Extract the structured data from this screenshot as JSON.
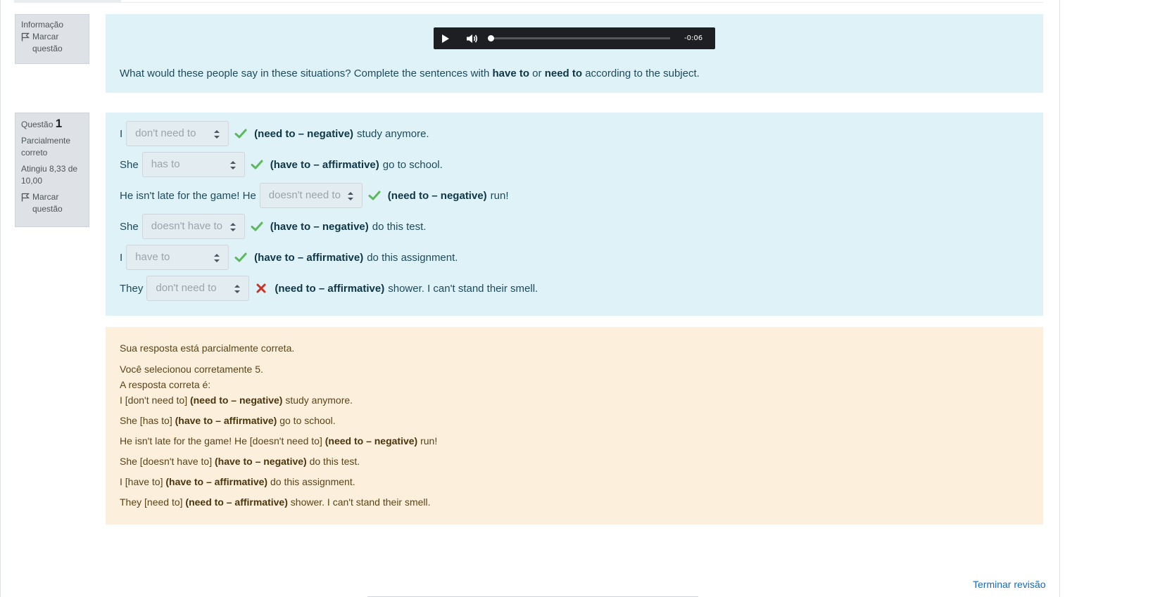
{
  "info_box": {
    "title": "Informação",
    "flag_label": "Marcar questão"
  },
  "info_panel": {
    "audio": {
      "time": "-0:06"
    },
    "instruction_pre": "What would these people say in these situations? Complete the sentences with ",
    "instruction_bold1": "have to",
    "instruction_mid": " or ",
    "instruction_bold2": "need to",
    "instruction_post": " according to the subject."
  },
  "question_box": {
    "label": "Questão",
    "number": "1",
    "state": "Parcialmente correto",
    "grade": "Atingiu 8,33 de 10,00",
    "flag_label": "Marcar questão"
  },
  "question": {
    "rows": [
      {
        "pre": "I",
        "selected": "don't need to",
        "mark": "correct",
        "hint": "(need to – negative)",
        "post": "study anymore."
      },
      {
        "pre": "She",
        "selected": "has to",
        "mark": "correct",
        "hint": "(have to – affirmative)",
        "post": "go to school."
      },
      {
        "pre": "He isn't late for the game! He",
        "selected": "doesn't need to",
        "mark": "correct",
        "hint": "(need to – negative)",
        "post": "run!"
      },
      {
        "pre": "She",
        "selected": "doesn't have to",
        "mark": "correct",
        "hint": "(have to – negative)",
        "post": "do this test."
      },
      {
        "pre": "I",
        "selected": "have to",
        "mark": "correct",
        "hint": "(have to – affirmative)",
        "post": "do this assignment."
      },
      {
        "pre": "They",
        "selected": "don't need to",
        "mark": "incorrect",
        "hint": "(need to – affirmative)",
        "post": "shower. I can't stand their smell."
      }
    ]
  },
  "feedback": {
    "summary": "Sua resposta está parcialmente correta.",
    "count": "Você selecionou corretamente 5.",
    "answer_heading": "A resposta correta é:",
    "answers": [
      {
        "pre": "I [don't need to] ",
        "hint": "(need to – negative)",
        "post": " study anymore."
      },
      {
        "pre": "She [has to] ",
        "hint": "(have to – affirmative)",
        "post": " go to school."
      },
      {
        "pre": "He isn't late for the game! He [doesn't need to] ",
        "hint": "(need to – negative)",
        "post": " run!"
      },
      {
        "pre": "She [doesn't have to] ",
        "hint": "(have to – negative)",
        "post": " do this test."
      },
      {
        "pre": "I [have to] ",
        "hint": "(have to – affirmative)",
        "post": " do this assignment."
      },
      {
        "pre": "They [need to] ",
        "hint": "(need to – affirmative)",
        "post": " shower. I can't stand their smell."
      }
    ]
  },
  "footer": {
    "finish_review": "Terminar revisão"
  },
  "colors": {
    "info_bg": "#def2f8",
    "feedback_bg": "#fcefdc",
    "correct": "#5cb85c",
    "incorrect": "#ca3120",
    "link": "#0f6cbf"
  }
}
